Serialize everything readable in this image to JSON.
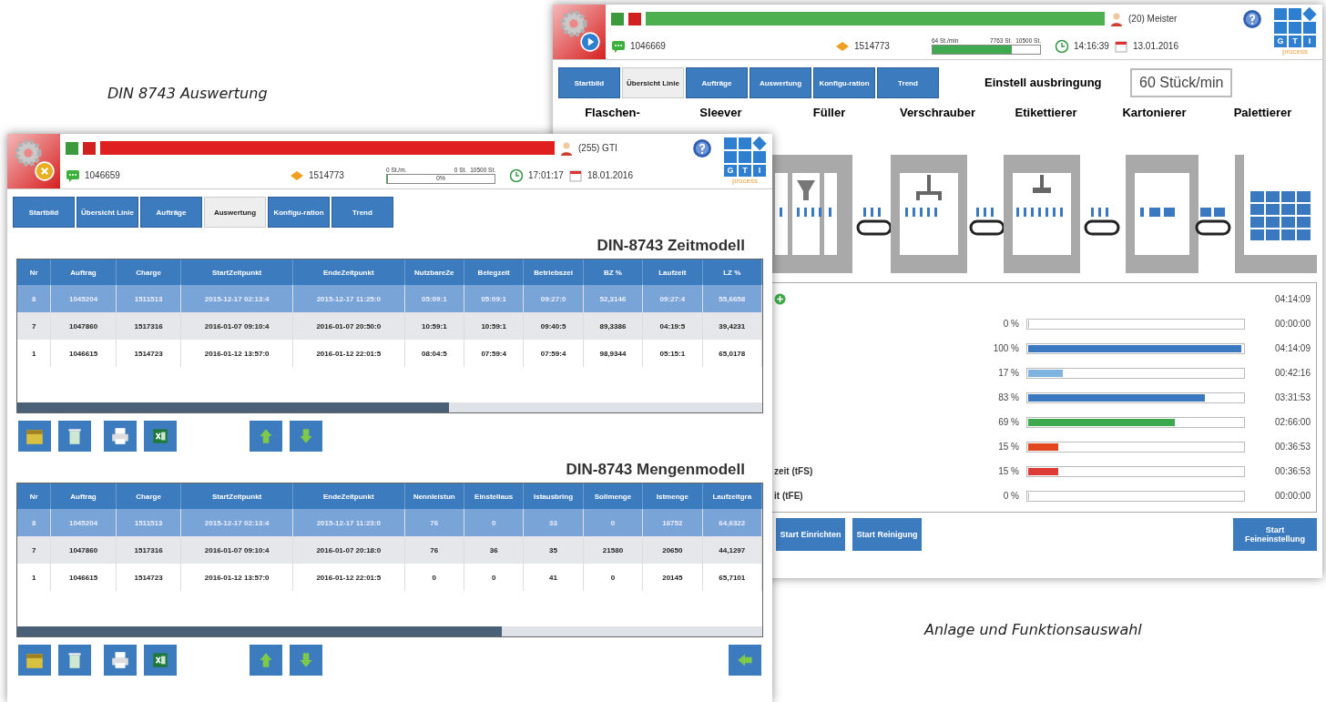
{
  "captions": [
    {
      "text": "DIN 8743 Auswertung"
    },
    {
      "text": "Anlage und Funktionsauswahl"
    }
  ],
  "line_window": {
    "header": {
      "kind": "running",
      "user": "(20) Meister",
      "order": "1046669",
      "charge": "1514773",
      "rate": "64 St./min",
      "count": "7763 St.",
      "target": "10500 St.",
      "level": 0.74,
      "time": "14:16:39",
      "date": "13.01.2016"
    },
    "logo": {
      "letters": [
        "G",
        "T",
        "I"
      ],
      "tagline": "process"
    },
    "tabs": [
      {
        "label": "Startbild",
        "selected": false
      },
      {
        "label": "Übersicht Linie",
        "selected": true
      },
      {
        "label": "Aufträge",
        "selected": false
      },
      {
        "label": "Auswertung",
        "selected": false
      },
      {
        "label": "Konfigu-ration",
        "selected": false
      },
      {
        "label": "Trend",
        "selected": false
      }
    ],
    "output_setting": {
      "label": "Einstell ausbringung",
      "value": "60 Stück/min"
    },
    "stations": [
      "Flaschen-",
      "Sleever",
      "Füller",
      "Verschrauber",
      "Etikettierer",
      "Kartonierer",
      "Palettierer"
    ],
    "times": [
      {
        "kind": "total",
        "time": "04:14:09"
      },
      {
        "kind": "bar",
        "percent": "0 %",
        "level": 0,
        "time": "00:00:00"
      },
      {
        "kind": "bar",
        "percent": "100 %",
        "level": 1,
        "color": "#3a78c0",
        "time": "04:14:09"
      },
      {
        "kind": "bar",
        "percent": "17 %",
        "level": 0.17,
        "color": "#7fb3e0",
        "time": "00:42:16"
      },
      {
        "kind": "bar",
        "percent": "83 %",
        "level": 0.83,
        "color": "#3a78c0",
        "time": "03:31:53"
      },
      {
        "kind": "bar",
        "percent": "69 %",
        "level": 0.69,
        "color": "#3fa94f",
        "time": "02:66:00"
      },
      {
        "kind": "bar",
        "percent": "15 %",
        "level": 0.15,
        "color": "#e2461f",
        "time": "00:36:53"
      },
      {
        "kind": "bar",
        "label": "zeit (tFS)",
        "percent": "15 %",
        "level": 0.15,
        "color": "#dd3b35",
        "time": "00:36:53"
      },
      {
        "kind": "bar",
        "label": "it (tFE)",
        "percent": "0 %",
        "level": 0,
        "time": "00:00:00"
      }
    ],
    "actions": [
      {
        "label": "Start Einrichten"
      },
      {
        "label": "Start Reinigung"
      },
      {
        "label": "Start Feineinstellung"
      }
    ]
  },
  "evaluation_window": {
    "header": {
      "kind": "fault",
      "user": "(255) GTI",
      "order": "1046659",
      "charge": "1514773",
      "rate": "0 St./m.",
      "count": "0 St.",
      "target": "10500 St.",
      "level": 0,
      "bar_label": "0%",
      "time": "17:01:17",
      "date": "18.01.2016"
    },
    "logo": {
      "letters": [
        "G",
        "T",
        "I"
      ],
      "tagline": "process"
    },
    "tabs": [
      {
        "label": "Startbild",
        "selected": false
      },
      {
        "label": "Übersicht Linie",
        "selected": false
      },
      {
        "label": "Aufträge",
        "selected": false
      },
      {
        "label": "Auswertung",
        "selected": true
      },
      {
        "label": "Konfigu-ration",
        "selected": false
      },
      {
        "label": "Trend",
        "selected": false
      }
    ],
    "tables": [
      {
        "title": "DIN-8743 Zeitmodell",
        "columns": [
          "Nr",
          "Auftrag",
          "Charge",
          "StartZeitpunkt",
          "EndeZeitpunkt",
          "NutzbareZe",
          "Belegzeit",
          "Betriebszei",
          "BZ %",
          "Laufzeit",
          "LZ %"
        ],
        "rows": [
          {
            "selected": true,
            "cells": [
              "8",
              "1045204",
              "1511513",
              "2015-12-17 02:13:4",
              "2015-12-17 11:25:0",
              "05:09:1",
              "05:09:1",
              "09:27:0",
              "52,3146",
              "09:27:4",
              "55,6658"
            ]
          },
          {
            "selected": false,
            "cells": [
              "7",
              "1047860",
              "1517316",
              "2016-01-07 09:10:4",
              "2016-01-07 20:50:0",
              "10:59:1",
              "10:59:1",
              "09:40:5",
              "89,3386",
              "04:19:5",
              "39,4231"
            ]
          },
          {
            "selected": false,
            "cells": [
              "1",
              "1046615",
              "1514723",
              "2016-01-12 13:57:0",
              "2016-01-12 22:01:5",
              "08:04:5",
              "07:59:4",
              "07:59:4",
              "98,9344",
              "05:15:1",
              "65,0178"
            ]
          }
        ]
      },
      {
        "title": "DIN-8743 Mengenmodell",
        "columns": [
          "Nr",
          "Auftrag",
          "Charge",
          "StartZeitpunkt",
          "EndeZeitpunkt",
          "Nennleistun",
          "Einstellaus",
          "Istausbring",
          "Sollmenge",
          "Istmenge",
          "Laufzeitgra"
        ],
        "rows": [
          {
            "selected": true,
            "cells": [
              "8",
              "1045204",
              "1511513",
              "2015-12-17 02:13:4",
              "2015-12-17 11:23:0",
              "76",
              "0",
              "33",
              "0",
              "16752",
              "64,6322"
            ]
          },
          {
            "selected": false,
            "cells": [
              "7",
              "1047860",
              "1517316",
              "2016-01-07 09:10:4",
              "2016-01-07 20:18:0",
              "76",
              "36",
              "35",
              "21580",
              "20650",
              "44,1297"
            ]
          },
          {
            "selected": false,
            "cells": [
              "1",
              "1046615",
              "1514723",
              "2016-01-12 13:57:0",
              "2016-01-12 22:01:5",
              "0",
              "0",
              "41",
              "0",
              "20145",
              "65,7101"
            ]
          }
        ],
        "back_button": true
      }
    ]
  }
}
